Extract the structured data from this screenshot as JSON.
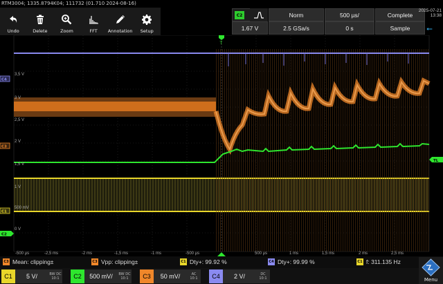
{
  "window": {
    "title": "RTM3004; 1335.8794K04; 111732 (01.710 2024-08-16)"
  },
  "toolbar": {
    "items": [
      {
        "label": "Undo",
        "icon": "undo-icon"
      },
      {
        "label": "Delete",
        "icon": "trash-icon"
      },
      {
        "label": "Zoom",
        "icon": "zoom-icon"
      },
      {
        "label": "FFT",
        "icon": "fft-icon"
      },
      {
        "label": "Annotation",
        "icon": "pen-icon"
      },
      {
        "label": "Setup",
        "icon": "gear-icon"
      }
    ]
  },
  "trigger": {
    "source": "C2",
    "mode": "Norm",
    "level": "1.67 V",
    "timebase": "500 µs/",
    "sample_rate": "2.5 GSa/s",
    "position": "0 s",
    "acq_state": "Complete",
    "acq_mode": "Sample"
  },
  "clock": {
    "date": "2025-07-21",
    "time": "13:38"
  },
  "grid": {
    "y_labels": [
      "3,5 V",
      "3 V",
      "2,5 V",
      "2 V",
      "1,5 V",
      "1 V",
      "500 mV",
      "0 V"
    ],
    "x_labels": [
      "-500 µs",
      "-2,5 ms",
      "-2 ms",
      "-1,5 ms",
      "-1 ms",
      "-500 µs",
      "500 µs",
      "1 ms",
      "1,5 ms",
      "2 ms",
      "2,5 ms"
    ],
    "left_markers": [
      "C4",
      "C3",
      "C1",
      "C2"
    ],
    "trigger_marker": "T",
    "level_marker": "TL"
  },
  "colors": {
    "c1": "#e8d62a",
    "c2": "#2ee62e",
    "c3": "#f0872a",
    "c4": "#8a8af0",
    "accent": "#2ecc2e"
  },
  "measurements": [
    {
      "badge": "C3",
      "text": "Mean: clipping±"
    },
    {
      "badge": "C3",
      "text": "Vpp: clipping±"
    },
    {
      "badge": "C1",
      "text": "Dty+: 99.92 %"
    },
    {
      "badge": "C4",
      "text": "Dty+: 99.99 %"
    },
    {
      "badge": "C1",
      "text": "f: 311.135 Hz"
    }
  ],
  "channels": [
    {
      "name": "C1",
      "scale": "5 V/",
      "bw": "BW",
      "coupling": "DC",
      "probe": "10:1"
    },
    {
      "name": "C2",
      "scale": "500 mV/",
      "bw": "BW",
      "coupling": "DC",
      "probe": "10:1"
    },
    {
      "name": "C3",
      "scale": "50 mV/",
      "bw": "",
      "coupling": "AC",
      "probe": "10:1"
    },
    {
      "name": "C4",
      "scale": "2 V/",
      "bw": "",
      "coupling": "DC",
      "probe": "10:1"
    }
  ],
  "menu": {
    "label": "Menu"
  }
}
